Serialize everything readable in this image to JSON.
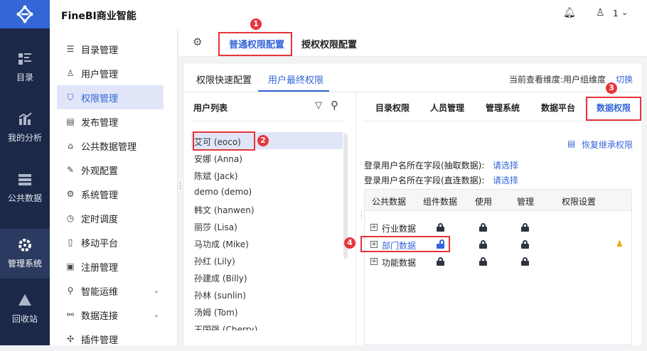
{
  "header": {
    "brand": "FineBI商业智能",
    "user": "1"
  },
  "nav": [
    {
      "label": "目录",
      "icon": "catalog-icon"
    },
    {
      "label": "我的分析",
      "icon": "chart-icon"
    },
    {
      "label": "公共数据",
      "icon": "database-icon"
    },
    {
      "label": "管理系统",
      "icon": "gear-icon",
      "active": true
    },
    {
      "label": "回收站",
      "icon": "recycle-icon"
    }
  ],
  "side": [
    {
      "label": "目录管理",
      "icon": "☰"
    },
    {
      "label": "用户管理",
      "icon": "♙"
    },
    {
      "label": "权限管理",
      "icon": "⛉",
      "active": true
    },
    {
      "label": "发布管理",
      "icon": "▤"
    },
    {
      "label": "公共数据管理",
      "icon": "⌂"
    },
    {
      "label": "外观配置",
      "icon": "✎"
    },
    {
      "label": "系统管理",
      "icon": "⚙"
    },
    {
      "label": "定时调度",
      "icon": "◷"
    },
    {
      "label": "移动平台",
      "icon": "▯"
    },
    {
      "label": "注册管理",
      "icon": "▣"
    },
    {
      "label": "智能运维",
      "icon": "⚲",
      "chevron": true
    },
    {
      "label": "数据连接",
      "icon": "⚯",
      "chevron": true
    },
    {
      "label": "插件管理",
      "icon": "✣"
    }
  ],
  "topbar": {
    "tabs": [
      "普通权限配置",
      "授权权限配置"
    ]
  },
  "subtabs": [
    "权限快速配置",
    "用户最终权限"
  ],
  "dimension": {
    "label": "当前查看维度:用户组维度",
    "switch": "切换"
  },
  "userlist": {
    "title": "用户列表",
    "users": [
      "艾可 (eoco)",
      "安娜 (Anna)",
      "陈斌 (Jack)",
      "demo (demo)",
      "韩文 (hanwen)",
      "丽莎 (Lisa)",
      "马功成 (Mike)",
      "孙红 (Lily)",
      "孙建成 (Billy)",
      "孙林 (sunlin)",
      "汤姆 (Tom)",
      "王国强 (Cherry)"
    ]
  },
  "permtabs": [
    "目录权限",
    "人员管理",
    "管理系统",
    "数据平台",
    "数据权限"
  ],
  "restore": "恢复继承权限",
  "fields": [
    {
      "label": "登录用户名所在字段(抽取数据):",
      "value": "请选择"
    },
    {
      "label": "登录用户名所在字段(直连数据):",
      "value": "请选择"
    }
  ],
  "table": {
    "headers": [
      "公共数据",
      "组件数据",
      "使用",
      "管理",
      "权限设置"
    ],
    "rows": [
      {
        "name": "行业数据",
        "locks": [
          "locked",
          "locked",
          "locked"
        ]
      },
      {
        "name": "部门数据",
        "locks": [
          "open",
          "locked",
          "locked"
        ],
        "highlight": true
      },
      {
        "name": "功能数据",
        "locks": [
          "locked",
          "locked",
          "locked"
        ]
      }
    ]
  },
  "badges": [
    "1",
    "2",
    "3",
    "4"
  ]
}
